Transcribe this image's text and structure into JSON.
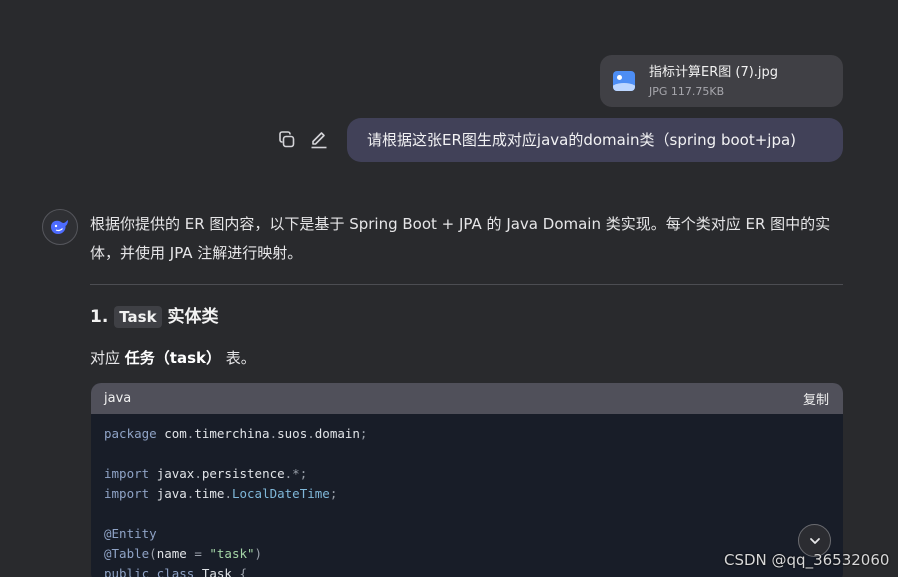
{
  "attachment": {
    "file_name": "指标计算ER图 (7).jpg",
    "file_info": "JPG 117.75KB",
    "icon": "image-icon"
  },
  "user_message": {
    "text": "请根据这张ER图生成对应java的domain类（spring boot+jpa)",
    "copy_icon": "copy-icon",
    "edit_icon": "edit-icon"
  },
  "assistant": {
    "avatar_icon": "whale-logo-icon",
    "intro": "根据你提供的 ER 图内容，以下是基于 Spring Boot + JPA 的 Java Domain 类实现。每个类对应 ER 图中的实体，并使用 JPA 注解进行映射。",
    "section": {
      "number": "1.",
      "code_word": "Task",
      "rest": "实体类"
    },
    "sub": {
      "prefix": "对应",
      "bold": "任务（task）",
      "suffix": "表。"
    },
    "code": {
      "language": "java",
      "copy_label": "复制",
      "lines": [
        "package com.timerchina.suos.domain;",
        "",
        "import javax.persistence.*;",
        "import java.time.LocalDateTime;",
        "",
        "@Entity",
        "@Table(name = \"task\")",
        "public class Task {"
      ]
    }
  },
  "scroll_button_icon": "chevron-down-icon",
  "watermark": "CSDN @qq_36532060"
}
